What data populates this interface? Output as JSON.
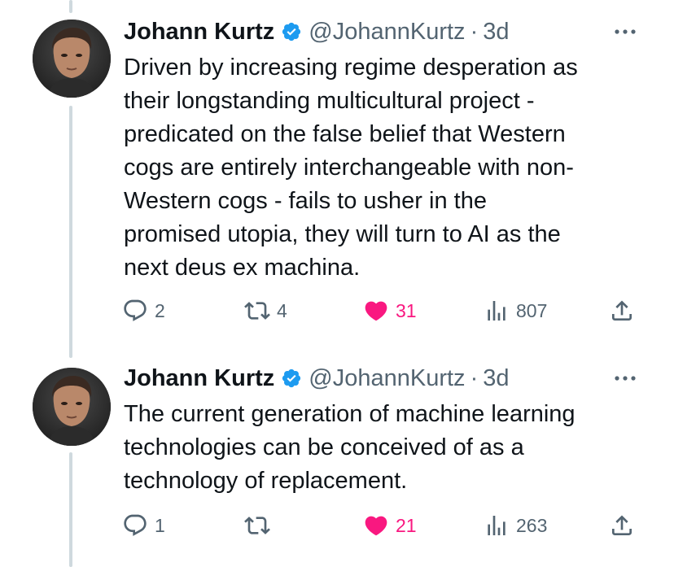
{
  "colors": {
    "accent": "#1d9bf0",
    "like": "#f91880",
    "muted": "#536471",
    "text": "#0f1419"
  },
  "tweets": [
    {
      "author_name": "Johann Kurtz",
      "handle": "@JohannKurtz",
      "separator": "·",
      "time": "3d",
      "lines": [
        "Driven by increasing regime desperation as",
        "their longstanding multicultural project -",
        "predicated on the false belief that Western",
        "cogs are entirely interchangeable with non-",
        "Western cogs - fails to usher in the",
        "promised utopia, they will turn to AI as the",
        "next deus ex machina."
      ],
      "replies": "2",
      "retweets": "4",
      "likes": "31",
      "views": "807",
      "liked": true,
      "icons": [
        "reply-icon",
        "retweet-icon",
        "heart-icon",
        "views-icon",
        "share-icon"
      ]
    },
    {
      "author_name": "Johann Kurtz",
      "handle": "@JohannKurtz",
      "separator": "·",
      "time": "3d",
      "lines": [
        "The current generation of machine learning",
        "technologies can be conceived of as a",
        "technology of replacement."
      ],
      "replies": "1",
      "retweets": "",
      "likes": "21",
      "views": "263",
      "liked": true,
      "icons": [
        "reply-icon",
        "retweet-icon",
        "heart-icon",
        "views-icon",
        "share-icon"
      ]
    }
  ]
}
